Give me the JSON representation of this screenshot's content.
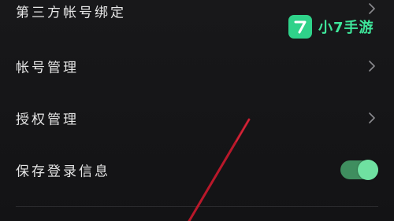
{
  "settings": {
    "items": [
      {
        "label": "第三方帐号绑定",
        "type": "link",
        "icon": "chevron-right-icon"
      },
      {
        "label": "帐号管理",
        "type": "link",
        "icon": "chevron-right-icon"
      },
      {
        "label": "授权管理",
        "type": "link",
        "icon": "chevron-right-icon"
      },
      {
        "label": "保存登录信息",
        "type": "toggle",
        "toggle_on": true
      }
    ]
  },
  "watermark": {
    "badge_text": "7",
    "text": "小7手游"
  },
  "colors": {
    "background": "#141416",
    "text": "#e6e6e6",
    "toggle_track": "#3f8e5f",
    "toggle_knob": "#6fe1a1",
    "watermark_green": "#2fd28a",
    "annotation_red": "#c2182b"
  }
}
